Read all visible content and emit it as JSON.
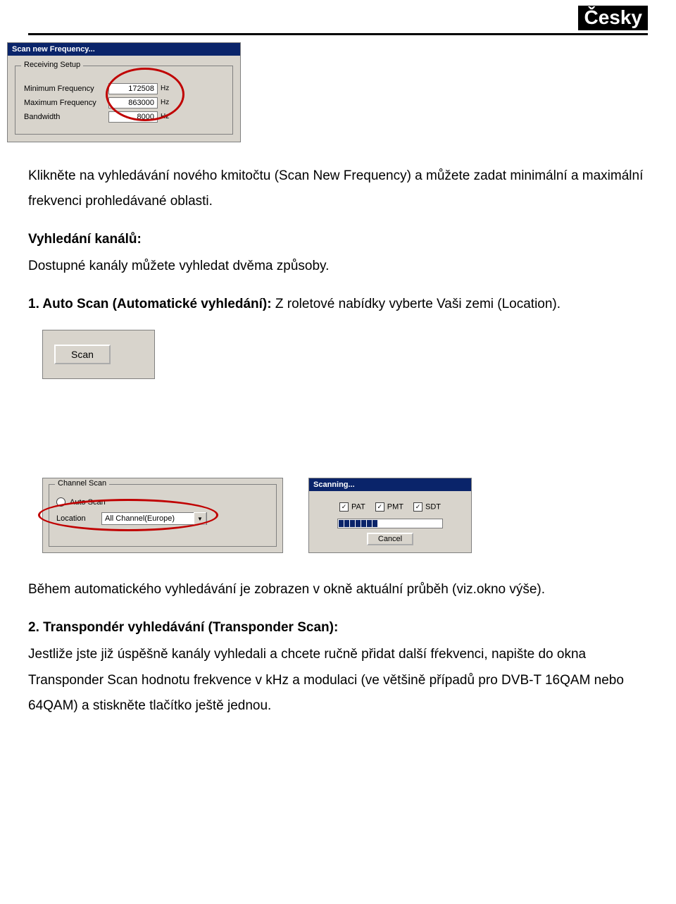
{
  "header": {
    "lang_badge": "Česky"
  },
  "fig1": {
    "title": "Scan new Frequency...",
    "groupbox_label": "Receiving Setup",
    "rows": [
      {
        "label": "Minimum Frequency",
        "value": "172508",
        "unit": "Hz"
      },
      {
        "label": "Maximum Frequency",
        "value": "863000",
        "unit": "Hz"
      },
      {
        "label": "Bandwidth",
        "value": "8000",
        "unit": "Hz"
      }
    ]
  },
  "fig2": {
    "button_label": "Scan"
  },
  "fig3": {
    "groupbox_label": "Channel Scan",
    "radio_label": "Auto Scan",
    "location_label": "Location",
    "combo_value": "All Channel(Europe)"
  },
  "fig4": {
    "title": "Scanning...",
    "checks": [
      "PAT",
      "PMT",
      "SDT"
    ],
    "cancel_label": "Cancel"
  },
  "text": {
    "p1": "Klikněte na vyhledávání nového kmitočtu (Scan New Frequency) a můžete zadat minimální a maximální frekvenci prohledávané oblasti.",
    "p2_bold": "Vyhledání kanálů:",
    "p3": "Dostupné kanály můžete vyhledat dvěma způsoby.",
    "p4a": "1. Auto Scan (Automatické vyhledání):",
    "p4b": "  Z roletové nabídky vyberte Vaši zemi (Location).",
    "p5": "Během automatického vyhledávání je zobrazen v okně aktuální průběh (viz.okno výše).",
    "p6_bold": "2. Transpondér vyhledávání (Transponder Scan):",
    "p7": "Jestliže jste již úspěšně kanály vyhledali a chcete ručně přidat další fŕekvenci, napište do okna Transponder Scan hodnotu frekvence v kHz a modulaci (ve většině případů pro DVB-T 16QAM nebo 64QAM) a stiskněte tlačítko ještě jednou."
  }
}
